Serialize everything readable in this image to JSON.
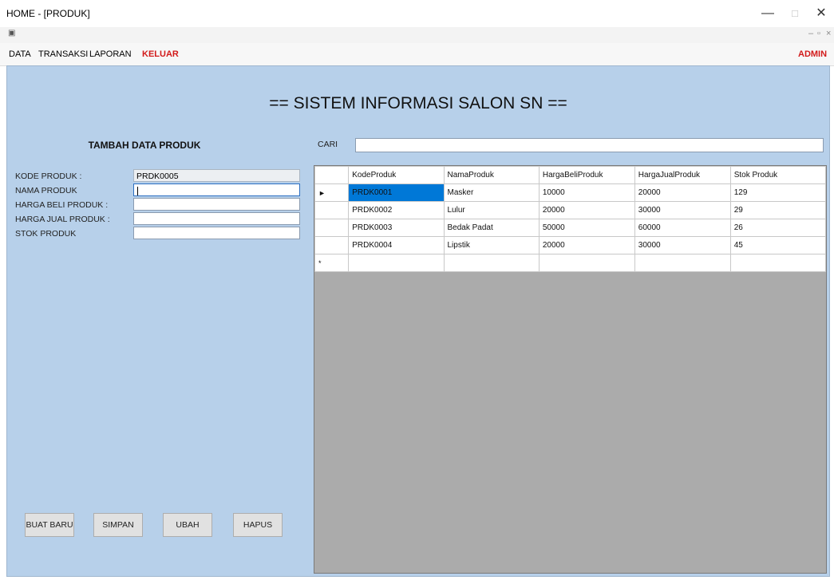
{
  "window": {
    "title": "HOME - [PRODUK]",
    "minimize_glyph": "—",
    "maximize_glyph": "□",
    "close_glyph": "✕",
    "mdi_icon": "▣",
    "mdi_min": "–",
    "mdi_restore": "▫",
    "mdi_close": "×"
  },
  "menu": {
    "items": [
      "DATA",
      "TRANSAKSI",
      "LAPORAN",
      "KELUAR"
    ],
    "user": "ADMIN"
  },
  "main": {
    "heading": "== SISTEM INFORMASI SALON SN =="
  },
  "form": {
    "title": "TAMBAH DATA PRODUK",
    "labels": {
      "kode": "KODE PRODUK :",
      "nama": "NAMA PRODUK",
      "harga_beli": "HARGA BELI PRODUK :",
      "harga_jual": "HARGA JUAL PRODUK :",
      "stok": "STOK PRODUK"
    },
    "values": {
      "kode": "PRDK0005",
      "nama": "",
      "harga_beli": "",
      "harga_jual": "",
      "stok": ""
    }
  },
  "buttons": {
    "buat_baru": "BUAT BARU",
    "simpan": "SIMPAN",
    "ubah": "UBAH",
    "hapus": "HAPUS"
  },
  "search": {
    "label": "CARI",
    "value": ""
  },
  "table": {
    "columns": [
      "KodeProduk",
      "NamaProduk",
      "HargaBeliProduk",
      "HargaJualProduk",
      "Stok Produk"
    ],
    "rows": [
      [
        "PRDK0001",
        "Masker",
        "10000",
        "20000",
        "129"
      ],
      [
        "PRDK0002",
        "Lulur",
        "20000",
        "30000",
        "29"
      ],
      [
        "PRDK0003",
        "Bedak Padat",
        "50000",
        "60000",
        "26"
      ],
      [
        "PRDK0004",
        "Lipstik",
        "20000",
        "30000",
        "45"
      ]
    ],
    "current_row_marker": "►",
    "new_row_marker": "*"
  },
  "colors": {
    "client_background": "#b7d0ea",
    "menu_accent": "#d21a1a",
    "selection": "#0078d7"
  },
  "icons": [
    "window-minimize-icon",
    "window-maximize-icon",
    "window-close-icon",
    "mdi-child-icon"
  ]
}
